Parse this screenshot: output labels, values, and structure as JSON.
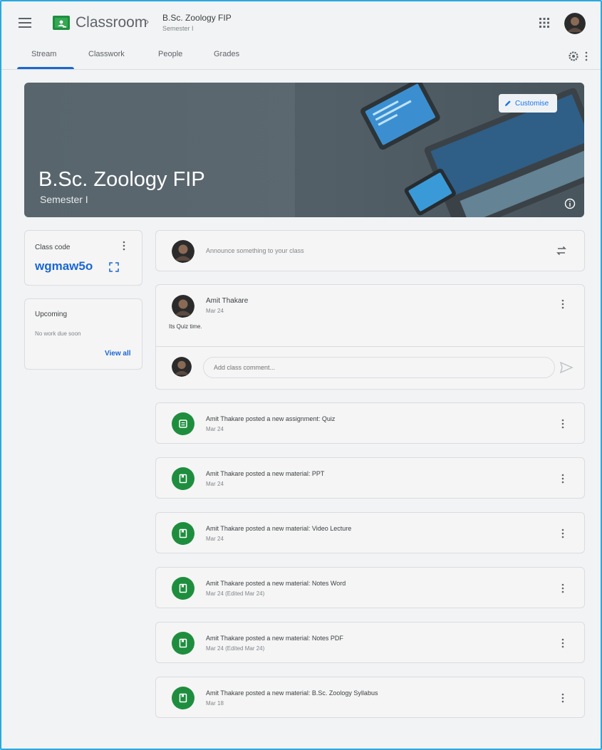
{
  "header": {
    "app_title": "Classroom",
    "class_title": "B.Sc. Zoology FIP",
    "class_subtitle": "Semester I",
    "icons": {
      "menu": "hamburger-menu-icon",
      "apps": "google-apps-icon",
      "avatar": "account-avatar"
    }
  },
  "tabs": [
    {
      "label": "Stream",
      "active": true
    },
    {
      "label": "Classwork"
    },
    {
      "label": "People"
    },
    {
      "label": "Grades"
    }
  ],
  "banner": {
    "title": "B.Sc. Zoology FIP",
    "subtitle": "Semester I",
    "customise_label": "Customise"
  },
  "class_code": {
    "label": "Class code",
    "code": "wgmaw5o"
  },
  "upcoming": {
    "label": "Upcoming",
    "empty_text": "No work due soon",
    "view_all": "View all"
  },
  "announce": {
    "placeholder": "Announce something to your class"
  },
  "post": {
    "author": "Amit Thakare",
    "date": "Mar 24",
    "text": "Its Quiz time.",
    "comment_placeholder": "Add class comment..."
  },
  "stream_items": [
    {
      "title": "Amit Thakare posted a new assignment: Quiz",
      "date": "Mar 24",
      "kind": "assignment"
    },
    {
      "title": "Amit Thakare posted a new material: PPT",
      "date": "Mar 24",
      "kind": "material"
    },
    {
      "title": "Amit Thakare posted a new material: Video Lecture",
      "date": "Mar 24",
      "kind": "material"
    },
    {
      "title": "Amit Thakare posted a new material: Notes Word",
      "date": "Mar 24 (Edited Mar 24)",
      "kind": "material"
    },
    {
      "title": "Amit Thakare posted a new material: Notes PDF",
      "date": "Mar 24 (Edited Mar 24)",
      "kind": "material"
    },
    {
      "title": "Amit Thakare posted a new material: B.Sc. Zoology Syllabus",
      "date": "Mar 18",
      "kind": "material"
    }
  ],
  "colors": {
    "accent": "#1967d2",
    "green": "#1e8e3e",
    "banner": "#5c6870",
    "frame": "#29a8e0"
  }
}
